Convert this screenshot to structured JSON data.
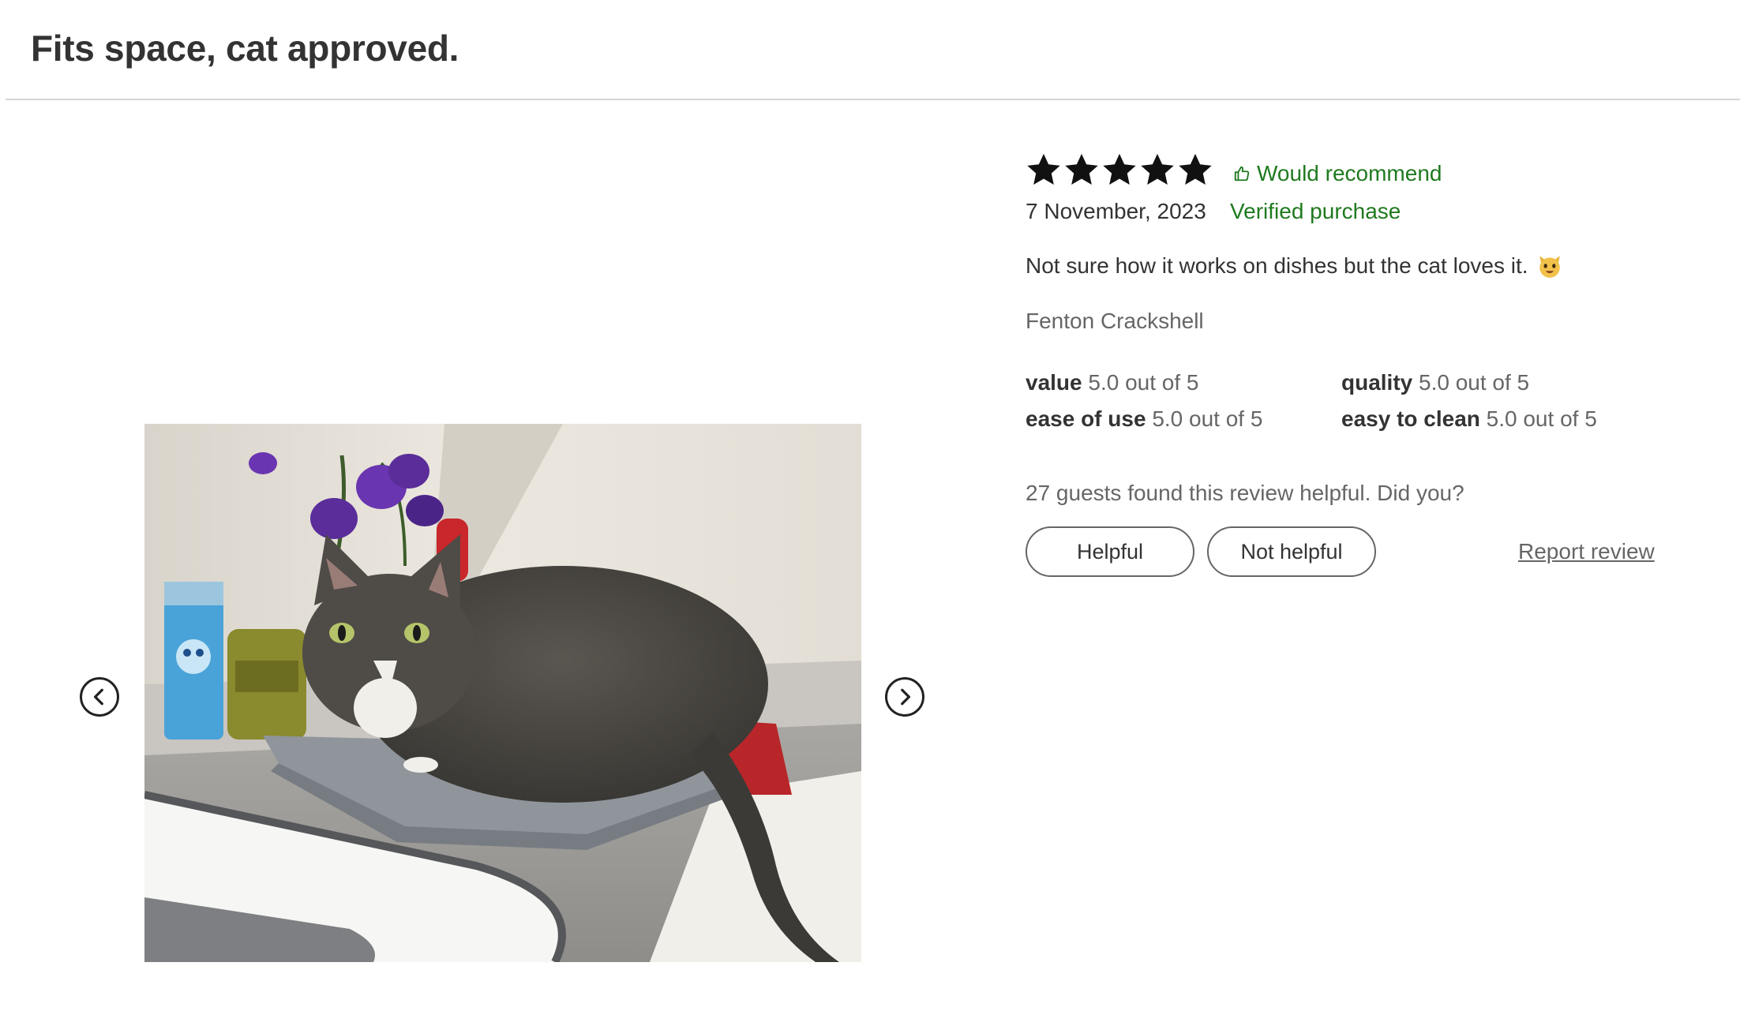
{
  "review": {
    "title": "Fits space, cat approved.",
    "rating": 5,
    "rating_max": 5,
    "recommend_label": "Would recommend",
    "date": "7 November, 2023",
    "verified_label": "Verified purchase",
    "text": "Not sure how it works on dishes but the cat loves it.",
    "emoji": "cat-face-icon",
    "author": "Fenton Crackshell"
  },
  "ratings": [
    {
      "label": "value",
      "score": "5.0 out of 5"
    },
    {
      "label": "quality",
      "score": "5.0 out of 5"
    },
    {
      "label": "ease of use",
      "score": "5.0 out of 5"
    },
    {
      "label": "easy to clean",
      "score": "5.0 out of 5"
    }
  ],
  "feedback": {
    "helpful_count_text": "27 guests found this review helpful. Did you?",
    "helpful_button": "Helpful",
    "not_helpful_button": "Not helpful",
    "report_link": "Report review"
  },
  "gallery": {
    "photo_subject": "cat on dish drying mat",
    "prev_icon": "chevron-left-icon",
    "next_icon": "chevron-right-icon"
  },
  "colors": {
    "accent_green": "#1f7a1f",
    "star": "#111111",
    "text": "#333333",
    "muted": "#666666"
  }
}
